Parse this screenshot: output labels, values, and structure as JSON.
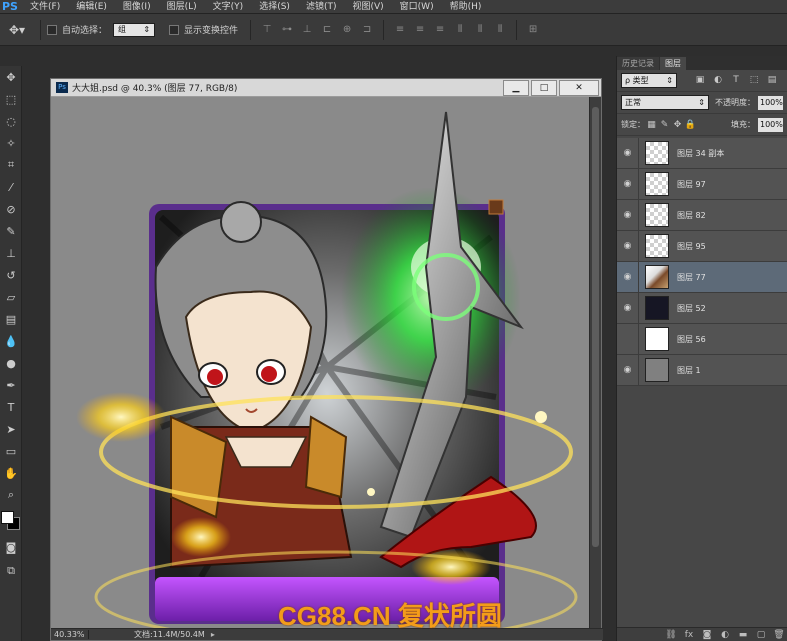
{
  "app": {
    "logo": "PS",
    "menu": [
      "文件(F)",
      "编辑(E)",
      "图像(I)",
      "图层(L)",
      "文字(Y)",
      "选择(S)",
      "滤镜(T)",
      "视图(V)",
      "窗口(W)",
      "帮助(H)"
    ]
  },
  "options": {
    "auto_select_label": "自动选择：",
    "auto_select_value": "组",
    "show_transform_label": "显示变换控件"
  },
  "document": {
    "title": "大大姐.psd @ 40.3% (图层 77, RGB/8)",
    "zoom": "40.33%",
    "doc_info": "文档:11.4M/50.4M"
  },
  "panel": {
    "tabs": [
      "历史记录",
      "图层"
    ],
    "filter_kind": "ρ 类型",
    "blend_mode": "正常",
    "opacity_label": "不透明度：",
    "opacity_value": "100%",
    "lock_label": "锁定：",
    "fill_label": "填充：",
    "fill_value": "100%"
  },
  "layers": [
    {
      "name": "图层 34 副本",
      "visible": true,
      "thumb": "checker",
      "selected": false
    },
    {
      "name": "图层 97",
      "visible": true,
      "thumb": "checker",
      "selected": false
    },
    {
      "name": "图层 82",
      "visible": true,
      "thumb": "checker",
      "selected": false
    },
    {
      "name": "图层 95",
      "visible": true,
      "thumb": "checker",
      "selected": false
    },
    {
      "name": "图层 77",
      "visible": true,
      "thumb": "char",
      "selected": true
    },
    {
      "name": "图层 52",
      "visible": true,
      "thumb": "dark",
      "selected": false
    },
    {
      "name": "图层 56",
      "visible": false,
      "thumb": "white",
      "selected": false
    },
    {
      "name": "图层 1",
      "visible": true,
      "thumb": "gray",
      "selected": false
    }
  ],
  "watermark": "CG88.CN 复状所圆",
  "colors": {
    "card_frame": "#8b4fc9",
    "card_bottom": "#9b3fd1",
    "glow_green": "#39ff4a",
    "glow_yellow": "#ffd21a",
    "watermark": "#f39c1a",
    "selected_layer": "#5d6a78"
  }
}
